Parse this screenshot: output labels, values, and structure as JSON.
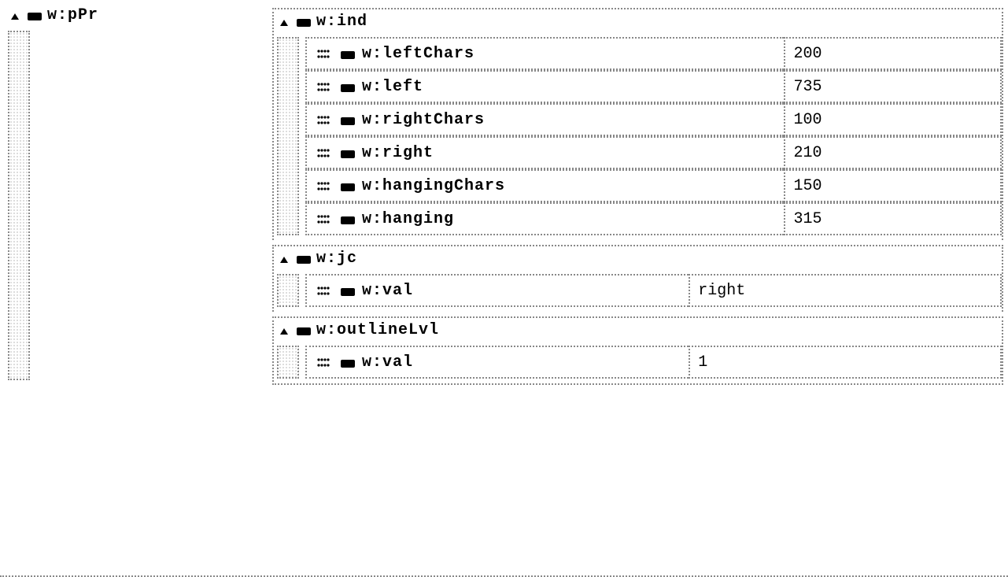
{
  "root": {
    "name": "w:pPr",
    "children": [
      {
        "name": "w:ind",
        "attrs": [
          {
            "name": "w:leftChars",
            "value": "200"
          },
          {
            "name": "w:left",
            "value": "735"
          },
          {
            "name": "w:rightChars",
            "value": "100"
          },
          {
            "name": "w:right",
            "value": "210"
          },
          {
            "name": "w:hangingChars",
            "value": "150"
          },
          {
            "name": "w:hanging",
            "value": "315"
          }
        ]
      },
      {
        "name": "w:jc",
        "attrs": [
          {
            "name": "w:val",
            "value": "right"
          }
        ]
      },
      {
        "name": "w:outlineLvl",
        "attrs": [
          {
            "name": "w:val",
            "value": "1"
          }
        ]
      }
    ]
  }
}
